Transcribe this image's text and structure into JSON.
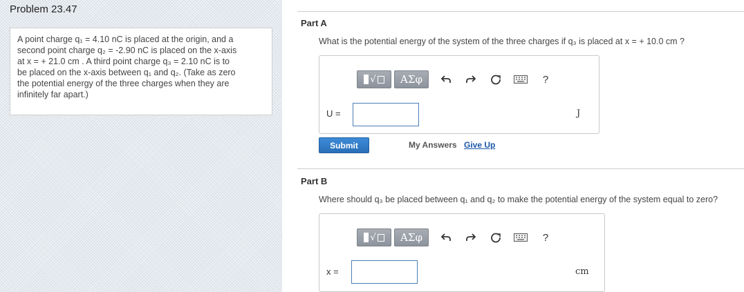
{
  "problem": {
    "title": "Problem 23.47",
    "lines": [
      "A point charge q₁ = 4.10 nC is placed at the origin, and a",
      "second point charge q₂ = -2.90 nC is placed on the x-axis",
      "at x = + 21.0 cm . A third point charge q₃ = 2.10 nC is to",
      "be placed on the x-axis between q₁ and q₂. (Take as zero",
      "the potential energy of the three charges when they are",
      "infinitely far apart.)"
    ]
  },
  "part_a": {
    "label": "Part A",
    "question": "What is the potential energy of the system of the three charges if q₃ is placed at x = + 10.0 cm ?",
    "var_label": "U =",
    "unit": "J",
    "input_value": ""
  },
  "part_b": {
    "label": "Part B",
    "question": "Where should q₃ be placed between q₁ and q₂ to make the potential energy of the system equal to zero?",
    "var_label": "x =",
    "unit": "cm",
    "input_value": ""
  },
  "toolbar": {
    "greek_label": "ΑΣφ",
    "help_label": "?",
    "undo_icon": "undo-icon",
    "redo_icon": "redo-icon",
    "reset_icon": "reset-icon",
    "keyboard_icon": "keyboard-icon"
  },
  "actions": {
    "submit_label": "Submit",
    "my_answers_label": "My Answers",
    "give_up_label": "Give Up"
  },
  "colors": {
    "submit_blue": "#2a6fb8",
    "link_blue": "#1a56a8",
    "input_border": "#4a7eb8"
  }
}
